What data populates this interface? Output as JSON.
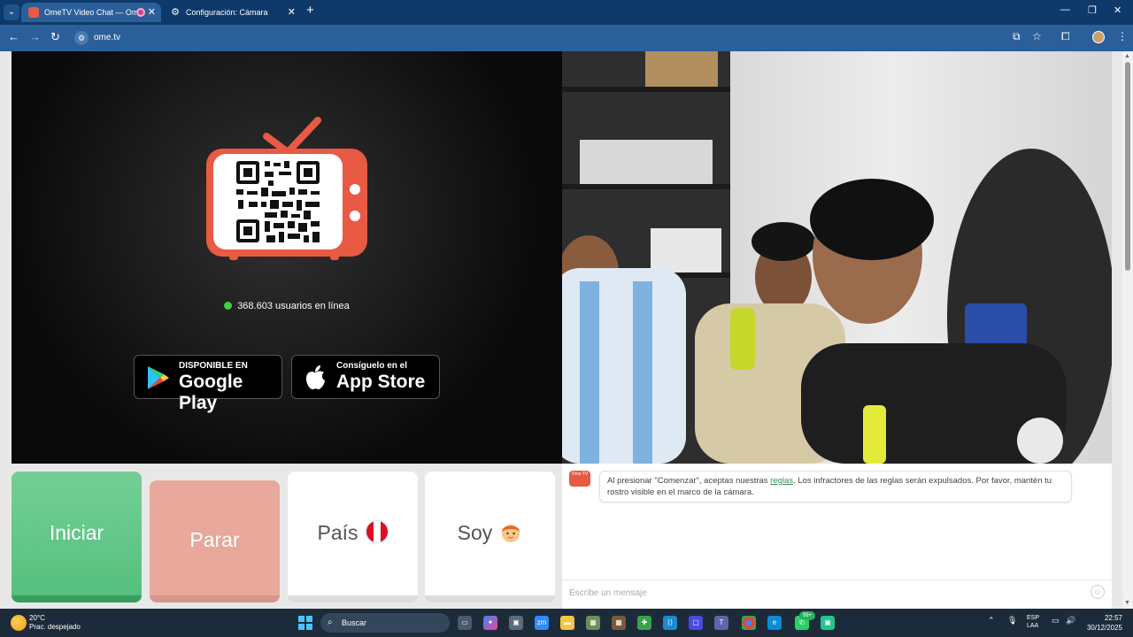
{
  "browser": {
    "tabs": [
      {
        "title": "OmeTV Video Chat — Ome"
      },
      {
        "title": "Configuración: Cámara"
      }
    ],
    "address": "ome.tv"
  },
  "stranger_panel": {
    "online_count": "368.603 usuarios en línea",
    "google_play": {
      "small": "DISPONIBLE EN",
      "big": "Google Play"
    },
    "app_store": {
      "small": "Consíguelo en el",
      "big": "App Store"
    }
  },
  "controls": {
    "start": "Iniciar",
    "stop": "Parar",
    "country": "País",
    "gender": "Soy"
  },
  "chat": {
    "logo_text": "Ome TV",
    "message_before": "Al presionar \"Comenzar\", aceptas nuestras ",
    "message_link": "reglas",
    "message_after": ". Los infractores de las reglas serán expulsados. Por favor, mantén tu rostro visible en el marco de la cámara.",
    "input_placeholder": "Escribe un mensaje"
  },
  "taskbar": {
    "temperature": "20°C",
    "weather": "Prac. despejado",
    "search": "Buscar",
    "language": "ESP",
    "layout": "LAA",
    "time": "22:57",
    "date": "30/12/2025",
    "badge": "99+"
  },
  "colors": {
    "brand": "#e85a43",
    "start_green": "#5cc384",
    "stop_pink": "#e8a89b",
    "tabstrip": "#0d3a6b",
    "toolbar": "#2a5f9a"
  }
}
